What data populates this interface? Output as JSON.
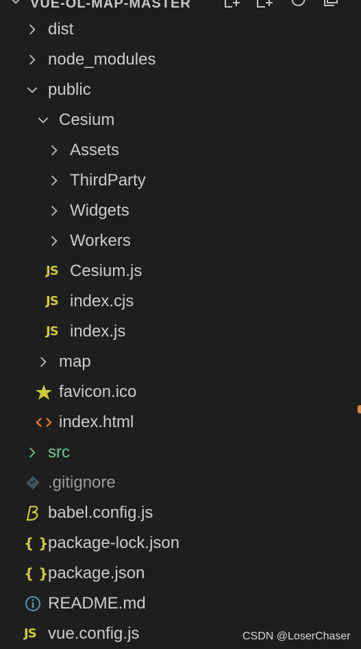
{
  "explorer": {
    "project_title": "VUE-OL-MAP-MASTER",
    "items": [
      {
        "label": "dist",
        "type": "folder",
        "depth": 0,
        "expanded": false
      },
      {
        "label": "node_modules",
        "type": "folder",
        "depth": 0,
        "expanded": false
      },
      {
        "label": "public",
        "type": "folder",
        "depth": 0,
        "expanded": true
      },
      {
        "label": "Cesium",
        "type": "folder",
        "depth": 1,
        "expanded": true
      },
      {
        "label": "Assets",
        "type": "folder",
        "depth": 2,
        "expanded": false
      },
      {
        "label": "ThirdParty",
        "type": "folder",
        "depth": 2,
        "expanded": false
      },
      {
        "label": "Widgets",
        "type": "folder",
        "depth": 2,
        "expanded": false
      },
      {
        "label": "Workers",
        "type": "folder",
        "depth": 2,
        "expanded": false
      },
      {
        "label": "Cesium.js",
        "type": "file",
        "depth": 2,
        "icon": "js-file-icon"
      },
      {
        "label": "index.cjs",
        "type": "file",
        "depth": 2,
        "icon": "js-file-icon"
      },
      {
        "label": "index.js",
        "type": "file",
        "depth": 2,
        "icon": "js-file-icon"
      },
      {
        "label": "map",
        "type": "folder",
        "depth": 1,
        "expanded": false
      },
      {
        "label": "favicon.ico",
        "type": "file",
        "depth": 1,
        "icon": "star-icon"
      },
      {
        "label": "index.html",
        "type": "file",
        "depth": 1,
        "icon": "html-file-icon"
      },
      {
        "label": "src",
        "type": "folder",
        "depth": 0,
        "expanded": false
      },
      {
        "label": ".gitignore",
        "type": "file",
        "depth": 0,
        "icon": "git-file-icon"
      },
      {
        "label": "babel.config.js",
        "type": "file",
        "depth": 0,
        "icon": "babel-icon"
      },
      {
        "label": "package-lock.json",
        "type": "file",
        "depth": 0,
        "icon": "json-file-icon"
      },
      {
        "label": "package.json",
        "type": "file",
        "depth": 0,
        "icon": "json-file-icon"
      },
      {
        "label": "README.md",
        "type": "file",
        "depth": 0,
        "icon": "info-icon"
      },
      {
        "label": "vue.config.js",
        "type": "file",
        "depth": 0,
        "icon": "js-file-icon"
      }
    ]
  },
  "header_actions": [
    {
      "icon": "new-file-icon"
    },
    {
      "icon": "new-folder-icon"
    },
    {
      "icon": "refresh-icon"
    },
    {
      "icon": "collapse-all-icon"
    }
  ],
  "file_icon_glyphs": {
    "js": "JS",
    "json": "{ }"
  },
  "colors": {
    "background": "#1e1e1e",
    "text": "#cccccc",
    "js_yellow": "#cbcb41",
    "html_orange": "#e37933",
    "info_blue": "#519aba",
    "git_gray": "#41535b",
    "untracked_green": "#73c991"
  },
  "watermark": "CSDN @LoserChaser"
}
